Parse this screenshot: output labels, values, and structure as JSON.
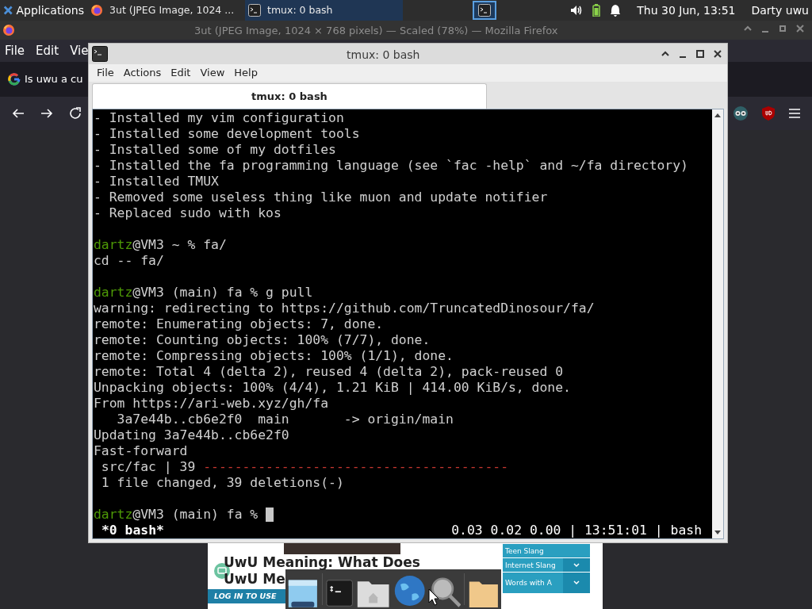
{
  "panel": {
    "applications": "Applications",
    "tasks": [
      {
        "label": "3ut (JPEG Image, 1024 ...",
        "kind": "firefox",
        "selected": false
      },
      {
        "label": "tmux: 0 bash",
        "kind": "terminal",
        "selected": true
      }
    ],
    "clock": "Thu 30 Jun, 13:51",
    "user": "Darty uwu"
  },
  "browser": {
    "title": "3ut (JPEG Image, 1024 × 768 pixels) — Scaled (78%) — Mozilla Firefox",
    "menu": [
      "File",
      "Edit",
      "Vie"
    ],
    "tab": "Is uwu a cu",
    "page": {
      "headings": [
        "UwU Meaning: What Does",
        "UwU Me"
      ],
      "banner": "LOG IN TO USE",
      "sidebar": [
        "Teen Slang",
        "Internet Slang",
        "Words with A"
      ]
    }
  },
  "terminal": {
    "title": "tmux: 0 bash",
    "menu": [
      "File",
      "Actions",
      "Edit",
      "View",
      "Help"
    ],
    "tab": "tmux: 0 bash",
    "lines": [
      {
        "spans": [
          {
            "text": "- Installed my vim configuration"
          }
        ]
      },
      {
        "spans": [
          {
            "text": "- Installed some development tools"
          }
        ]
      },
      {
        "spans": [
          {
            "text": "- Installed some of my dotfiles"
          }
        ]
      },
      {
        "spans": [
          {
            "text": "- Installed the fa programming language (see `fac -help` and ~/fa directory)"
          }
        ]
      },
      {
        "spans": [
          {
            "text": "- Installed TMUX"
          }
        ]
      },
      {
        "spans": [
          {
            "text": "- Removed some useless thing like muon and update notifier"
          }
        ]
      },
      {
        "spans": [
          {
            "text": "- Replaced sudo with kos"
          }
        ]
      },
      {
        "kind": "blank"
      },
      {
        "spans": [
          {
            "text": "dartz",
            "kind": "user"
          },
          {
            "text": "@VM3 ~ % fa/"
          }
        ]
      },
      {
        "spans": [
          {
            "text": "cd -- fa/"
          }
        ]
      },
      {
        "kind": "blank"
      },
      {
        "spans": [
          {
            "text": "dartz",
            "kind": "user"
          },
          {
            "text": "@VM3 (main) fa % g pull"
          }
        ]
      },
      {
        "spans": [
          {
            "text": "warning: redirecting to https://github.com/TruncatedDinosour/fa/"
          }
        ]
      },
      {
        "spans": [
          {
            "text": "remote: Enumerating objects: 7, done."
          }
        ]
      },
      {
        "spans": [
          {
            "text": "remote: Counting objects: 100% (7/7), done."
          }
        ]
      },
      {
        "spans": [
          {
            "text": "remote: Compressing objects: 100% (1/1), done."
          }
        ]
      },
      {
        "spans": [
          {
            "text": "remote: Total 4 (delta 2), reused 4 (delta 2), pack-reused 0"
          }
        ]
      },
      {
        "spans": [
          {
            "text": "Unpacking objects: 100% (4/4), 1.21 KiB | 414.00 KiB/s, done."
          }
        ]
      },
      {
        "spans": [
          {
            "text": "From https://ari-web.xyz/gh/fa"
          }
        ]
      },
      {
        "spans": [
          {
            "text": "   3a7e44b..cb6e2f0  main       -> origin/main"
          }
        ]
      },
      {
        "spans": [
          {
            "text": "Updating 3a7e44b..cb6e2f0"
          }
        ]
      },
      {
        "spans": [
          {
            "text": "Fast-forward"
          }
        ]
      },
      {
        "spans": [
          {
            "text": " src/fac | 39 "
          },
          {
            "text": "---------------------------------------",
            "kind": "deletion"
          }
        ]
      },
      {
        "spans": [
          {
            "text": " 1 file changed, 39 deletions(-)"
          }
        ]
      },
      {
        "kind": "blank"
      },
      {
        "spans": [
          {
            "text": "dartz",
            "kind": "user"
          },
          {
            "text": "@VM3 (main) fa % "
          }
        ],
        "cursor": true
      }
    ],
    "status": {
      "window": "*0 bash*",
      "info": "0.03 0.02 0.00 | 13:51:01 | bash"
    }
  }
}
